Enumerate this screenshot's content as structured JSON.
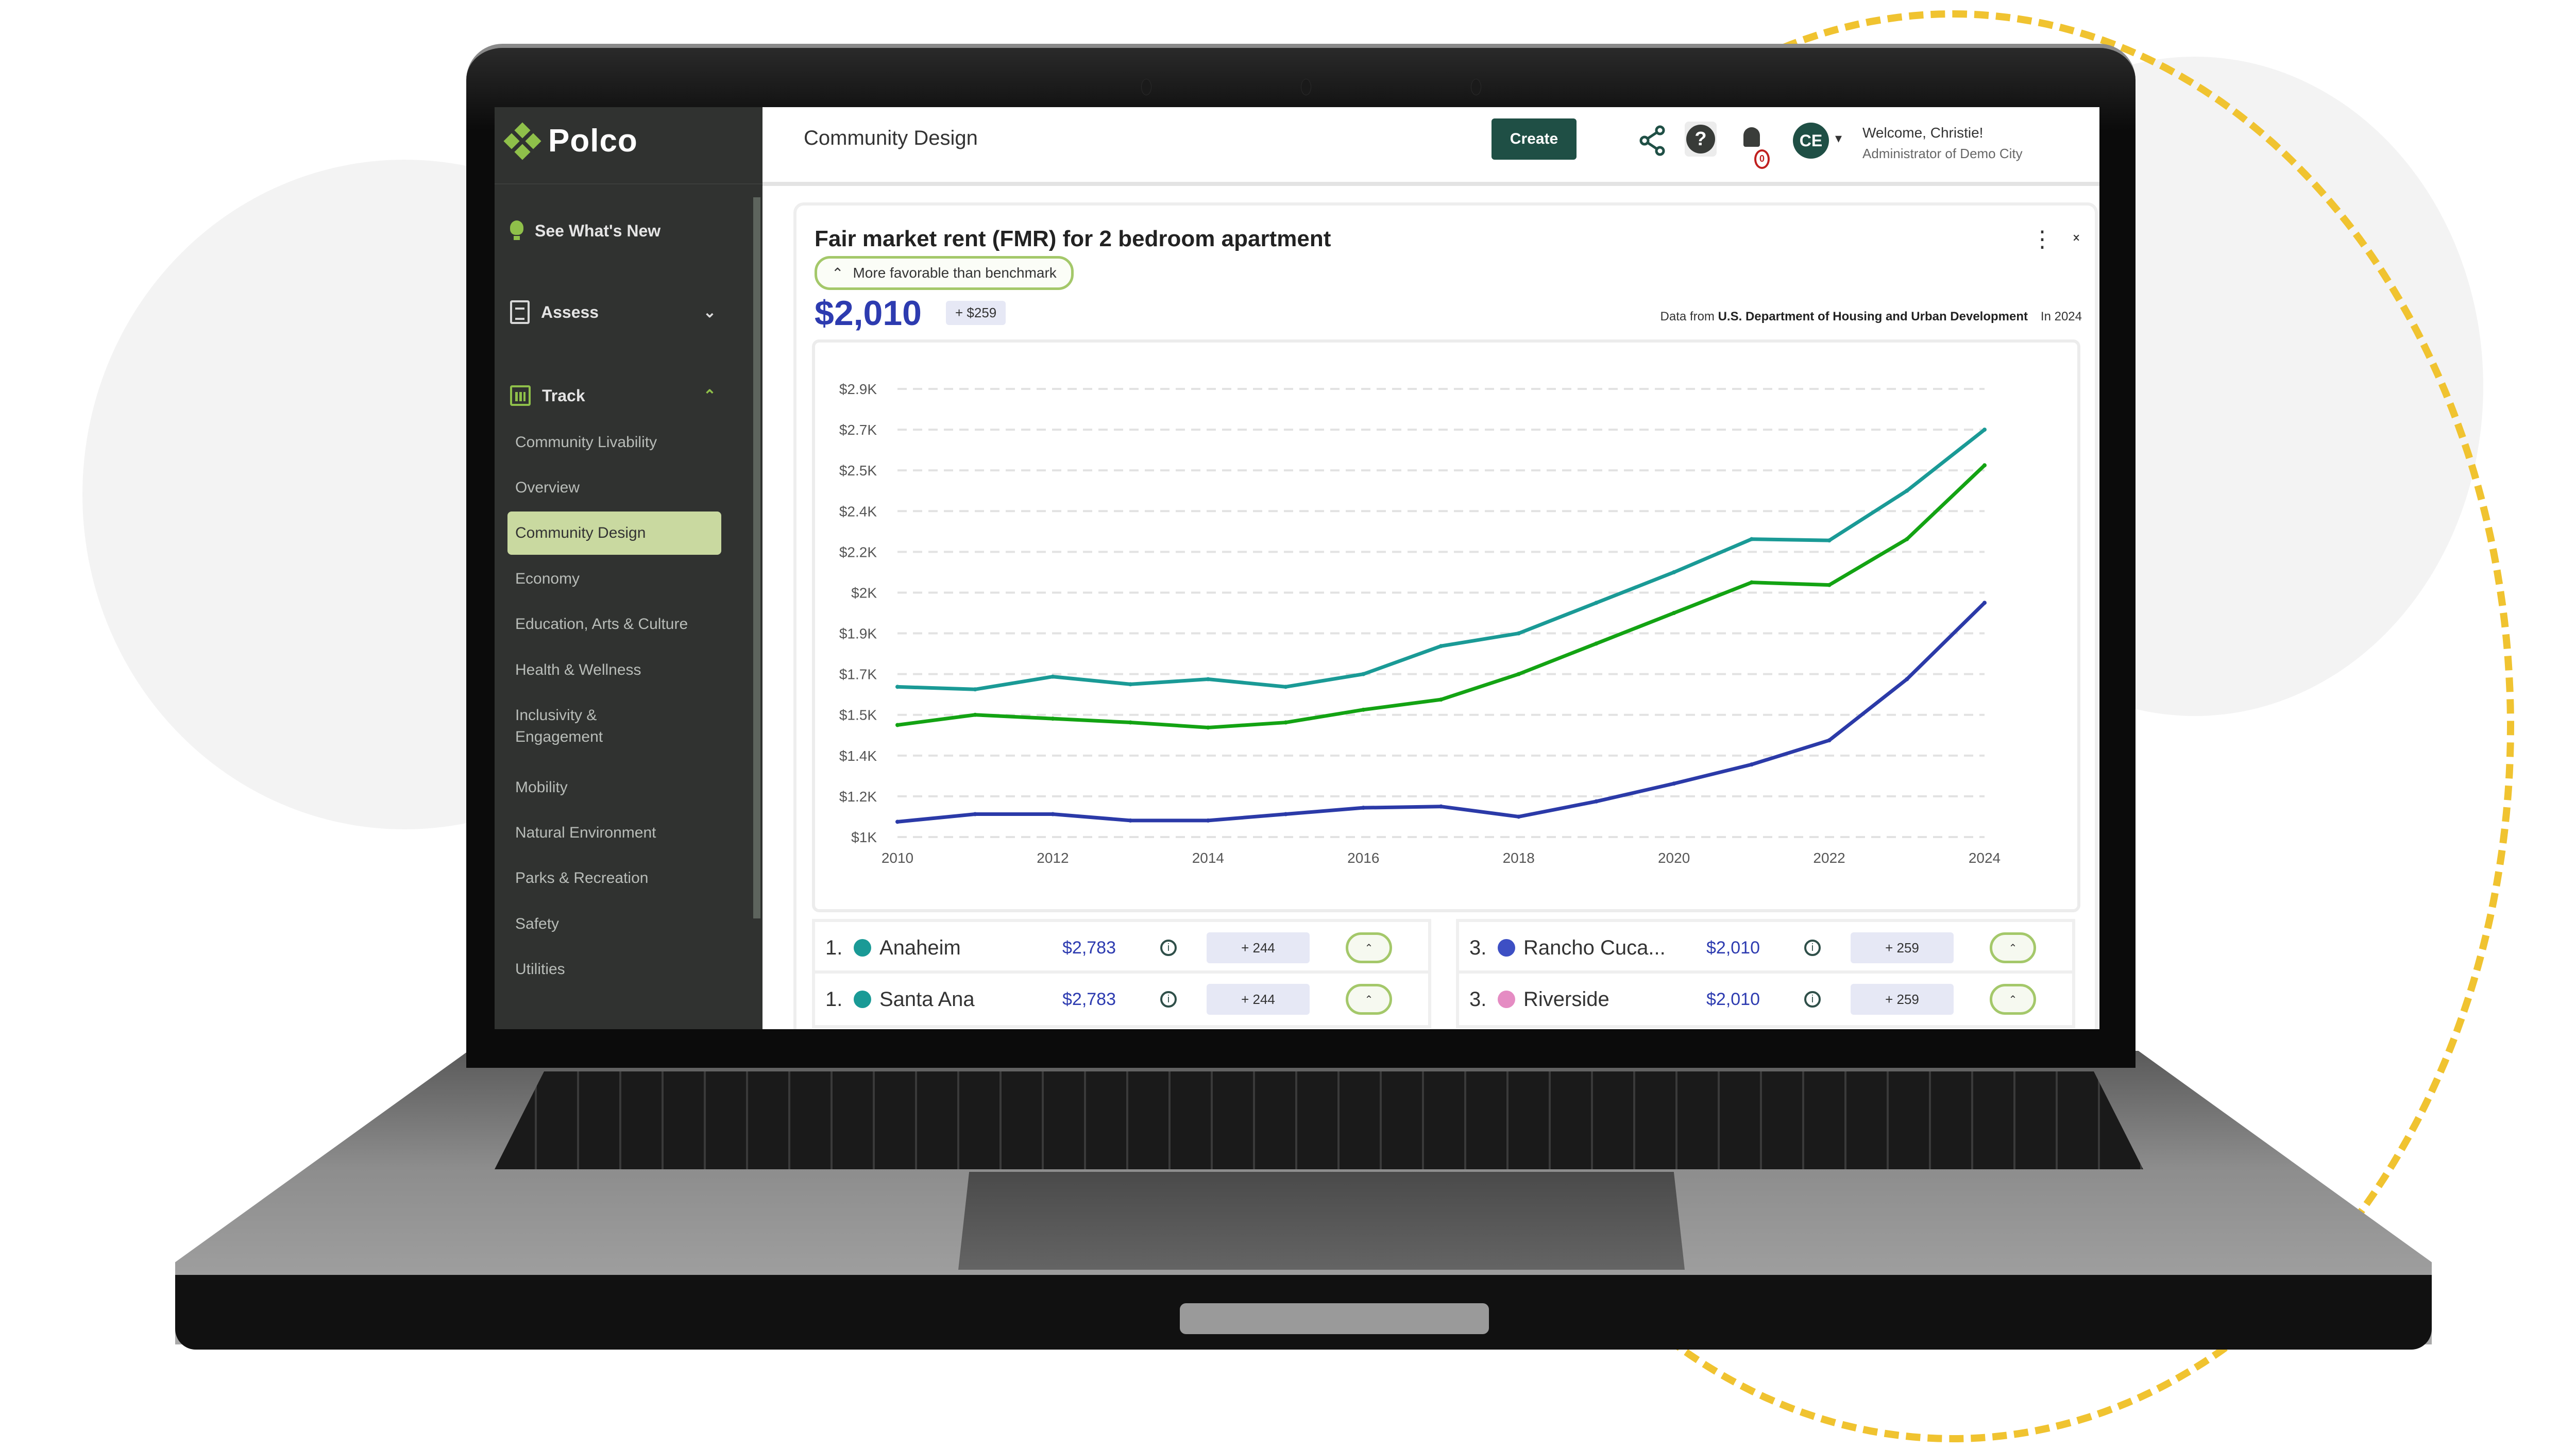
{
  "app": {
    "brand": "Polco",
    "page_title": "Community Design"
  },
  "sidebar": {
    "whats_new": "See What's New",
    "assess": "Assess",
    "track": "Track",
    "track_items": [
      {
        "label": "Community Livability",
        "active": false
      },
      {
        "label": "Overview",
        "active": false
      },
      {
        "label": "Community Design",
        "active": true
      },
      {
        "label": "Economy",
        "active": false
      },
      {
        "label": "Education, Arts & Culture",
        "active": false
      },
      {
        "label": "Health & Wellness",
        "active": false
      },
      {
        "label": "Inclusivity & Engagement",
        "active": false
      },
      {
        "label": "Mobility",
        "active": false
      },
      {
        "label": "Natural Environment",
        "active": false
      },
      {
        "label": "Parks & Recreation",
        "active": false
      },
      {
        "label": "Safety",
        "active": false
      },
      {
        "label": "Utilities",
        "active": false
      }
    ]
  },
  "header": {
    "create_label": "Create",
    "share_icon": "share-icon",
    "help_label": "?",
    "notification_count": "0",
    "avatar_initials": "CE",
    "welcome": "Welcome, Christie!",
    "role": "Administrator of Demo City"
  },
  "card": {
    "title": "Fair market rent (FMR) for 2 bedroom apartment",
    "benchmark_label": "More favorable than benchmark",
    "value": "$2,010",
    "delta": "+ $259",
    "source_prefix": "Data from",
    "source_name": "U.S. Department of Housing and Urban Development",
    "year_label": "In 2024",
    "menu_icon": "⋮",
    "collapse_icon": "⌄⌃"
  },
  "chart_data": {
    "type": "line",
    "title": "Fair market rent (FMR) for 2 bedroom apartment",
    "xlabel": "",
    "ylabel": "",
    "x": [
      2010,
      2011,
      2012,
      2013,
      2014,
      2015,
      2016,
      2017,
      2018,
      2019,
      2020,
      2021,
      2022,
      2023,
      2024
    ],
    "x_ticks": [
      "2010",
      "2012",
      "2014",
      "2016",
      "2018",
      "2020",
      "2022",
      "2024"
    ],
    "y_ticks": [
      "$1K",
      "$1.2K",
      "$1.4K",
      "$1.5K",
      "$1.7K",
      "$1.9K",
      "$2K",
      "$2.2K",
      "$2.4K",
      "$2.5K",
      "$2.7K",
      "$2.9K"
    ],
    "y_tick_values": [
      1000,
      1160,
      1320,
      1480,
      1640,
      1800,
      1960,
      2120,
      2280,
      2440,
      2600,
      2760
    ],
    "ylim": [
      1000,
      2760
    ],
    "grid": true,
    "legend": "none",
    "series": [
      {
        "name": "Anaheim / Santa Ana",
        "color": "#1a9a96",
        "values": [
          1590,
          1580,
          1630,
          1600,
          1620,
          1590,
          1640,
          1750,
          1800,
          1920,
          2040,
          2170,
          2165,
          2360,
          2600
        ]
      },
      {
        "name": "Benchmark",
        "color": "#13a313",
        "values": [
          1440,
          1480,
          1465,
          1450,
          1430,
          1450,
          1500,
          1540,
          1640,
          1760,
          1880,
          2000,
          1990,
          2170,
          2460
        ]
      },
      {
        "name": "Rancho Cucamonga / Riverside",
        "color": "#2b3aa8",
        "values": [
          1060,
          1090,
          1090,
          1065,
          1065,
          1090,
          1115,
          1120,
          1080,
          1140,
          1210,
          1285,
          1380,
          1620,
          1920
        ]
      }
    ]
  },
  "rankings": [
    {
      "rank": "1.",
      "name": "Anaheim",
      "value": "$2,783",
      "delta": "+ 244",
      "color": "#1a9a96"
    },
    {
      "rank": "3.",
      "name": "Rancho Cuca...",
      "value": "$2,010",
      "delta": "+ 259",
      "color": "#3d4fc4"
    },
    {
      "rank": "1.",
      "name": "Santa Ana",
      "value": "$2,783",
      "delta": "+ 244",
      "color": "#1a9a96"
    },
    {
      "rank": "3.",
      "name": "Riverside",
      "value": "$2,010",
      "delta": "+ 259",
      "color": "#e58cc3"
    }
  ]
}
